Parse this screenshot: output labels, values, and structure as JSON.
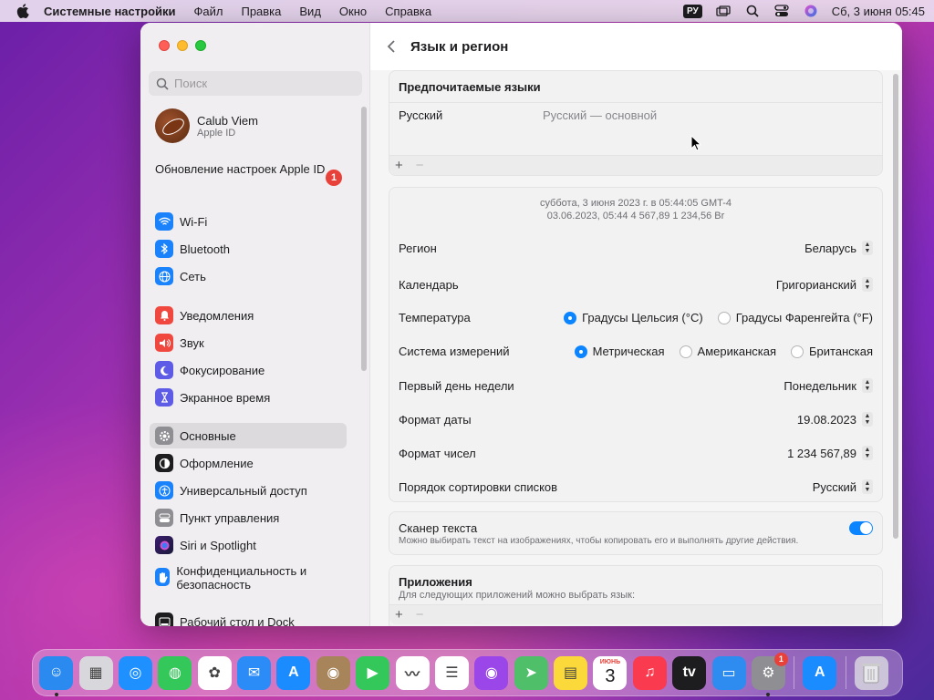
{
  "menubar": {
    "app_name": "Системные настройки",
    "items": [
      "Файл",
      "Правка",
      "Вид",
      "Окно",
      "Справка"
    ],
    "lang": "РУ",
    "datetime": "Сб, 3 июня  05:45"
  },
  "sidebar": {
    "search_placeholder": "Поиск",
    "profile": {
      "name": "Calub Viem",
      "sub": "Apple ID"
    },
    "update": {
      "label": "Обновление настроек Apple ID",
      "badge": "1"
    },
    "items": [
      {
        "label": "Wi-Fi",
        "icon": "wifi-icon",
        "color": "#1a82fb"
      },
      {
        "label": "Bluetooth",
        "icon": "bluetooth-icon",
        "color": "#1a82fb"
      },
      {
        "label": "Сеть",
        "icon": "globe-icon",
        "color": "#1a82fb"
      },
      {
        "label": "Уведомления",
        "icon": "bell-icon",
        "color": "#f0483e"
      },
      {
        "label": "Звук",
        "icon": "speaker-icon",
        "color": "#f0483e"
      },
      {
        "label": "Фокусирование",
        "icon": "moon-icon",
        "color": "#5e5ce6"
      },
      {
        "label": "Экранное время",
        "icon": "hourglass-icon",
        "color": "#5e5ce6"
      },
      {
        "label": "Основные",
        "icon": "gear-icon",
        "color": "#8e8e93"
      },
      {
        "label": "Оформление",
        "icon": "appearance-icon",
        "color": "#1d1d1f"
      },
      {
        "label": "Универсальный доступ",
        "icon": "accessibility-icon",
        "color": "#1a82fb"
      },
      {
        "label": "Пункт управления",
        "icon": "control-center-icon",
        "color": "#8e8e93"
      },
      {
        "label": "Siri и Spotlight",
        "icon": "siri-icon",
        "color": "#7b4fd6"
      },
      {
        "label": "Конфиденциальность и безопасность",
        "icon": "hand-icon",
        "color": "#1a82fb"
      },
      {
        "label": "Рабочий стол и Dock",
        "icon": "dock-icon",
        "color": "#1d1d1f"
      }
    ]
  },
  "main": {
    "title": "Язык и регион",
    "preferred": {
      "title": "Предпочитаемые языки",
      "lang": "Русский",
      "lang_desc": "Русский — основной"
    },
    "preview": {
      "line1": "суббота, 3 июня 2023 г. в 05:44:05 GMT-4",
      "line2": "03.06.2023, 05:44      4 567,89      1 234,56 Br"
    },
    "region": {
      "label": "Регион",
      "value": "Беларусь"
    },
    "calendar": {
      "label": "Календарь",
      "value": "Григорианский"
    },
    "temperature": {
      "label": "Температура",
      "opt1": "Градусы Цельсия (°C)",
      "opt2": "Градусы Фаренгейта (°F)"
    },
    "measure": {
      "label": "Система измерений",
      "opt1": "Метрическая",
      "opt2": "Американская",
      "opt3": "Британская"
    },
    "firstday": {
      "label": "Первый день недели",
      "value": "Понедельник"
    },
    "dateformat": {
      "label": "Формат даты",
      "value": "19.08.2023"
    },
    "numformat": {
      "label": "Формат чисел",
      "value": "1 234 567,89"
    },
    "sortorder": {
      "label": "Порядок сортировки списков",
      "value": "Русский"
    },
    "scanner": {
      "label": "Сканер текста",
      "desc": "Можно выбирать текст на изображениях, чтобы копировать его и выполнять другие действия."
    },
    "apps": {
      "title": "Приложения",
      "desc": "Для следующих приложений можно выбрать язык:"
    }
  },
  "dock": {
    "apps": [
      {
        "name": "finder-icon",
        "color": "#2a8af0",
        "glyph": "☺"
      },
      {
        "name": "launchpad-icon",
        "color": "#d8d8dc",
        "glyph": "▦"
      },
      {
        "name": "safari-icon",
        "color": "#1e90ff",
        "glyph": "◎"
      },
      {
        "name": "messages-icon",
        "color": "#34c759",
        "glyph": "◍"
      },
      {
        "name": "photos-icon",
        "color": "#ffffff",
        "glyph": "✿"
      },
      {
        "name": "mail-icon",
        "color": "#2b8cf7",
        "glyph": "✉"
      },
      {
        "name": "appstore-icon",
        "color": "#1a8cff",
        "glyph": "A"
      },
      {
        "name": "contacts-icon",
        "color": "#a8845a",
        "glyph": "◉"
      },
      {
        "name": "facetime-icon",
        "color": "#34c759",
        "glyph": "▶"
      },
      {
        "name": "freeform-icon",
        "color": "#ffffff",
        "glyph": "〰"
      },
      {
        "name": "reminders-icon",
        "color": "#ffffff",
        "glyph": "☰"
      },
      {
        "name": "podcasts-icon",
        "color": "#9a46e8",
        "glyph": "◉"
      },
      {
        "name": "maps-icon",
        "color": "#4fbf6a",
        "glyph": "➤"
      },
      {
        "name": "notes-icon",
        "color": "#fcd93a",
        "glyph": "▤"
      },
      {
        "name": "calendar-icon",
        "color": "#ffffff",
        "glyph": "3"
      },
      {
        "name": "music-icon",
        "color": "#fa3a4f",
        "glyph": "♫"
      },
      {
        "name": "tv-icon",
        "color": "#1d1d1f",
        "glyph": "tv"
      },
      {
        "name": "keynote-icon",
        "color": "#2e8cf0",
        "glyph": "▭"
      },
      {
        "name": "system-settings-icon",
        "color": "#8e8e93",
        "glyph": "⚙"
      }
    ],
    "settings_badge": "1",
    "calendar_month": "ИЮНЬ"
  }
}
